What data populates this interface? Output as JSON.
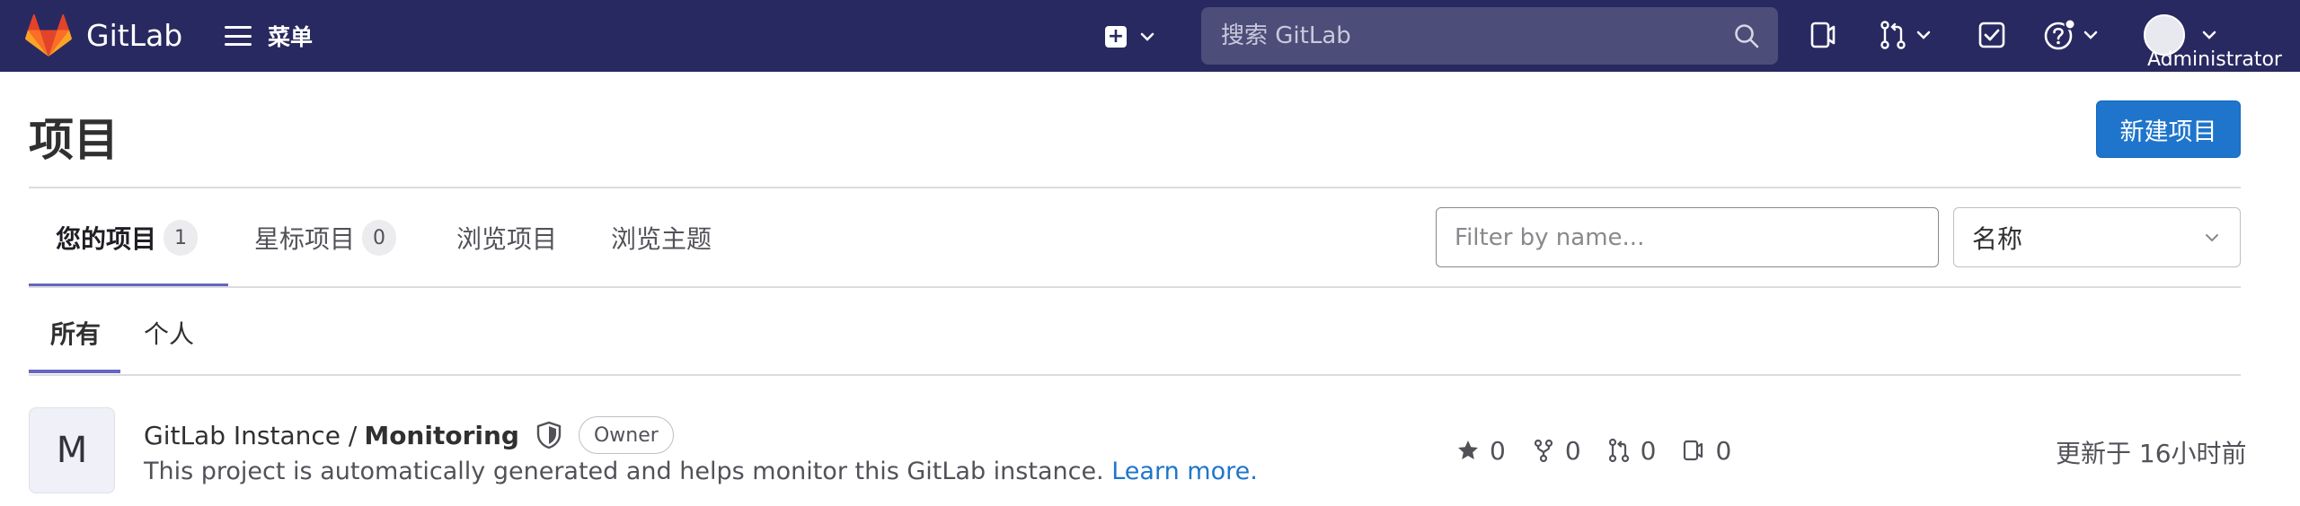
{
  "navbar": {
    "brand": "GitLab",
    "menu_label": "菜单",
    "search_placeholder": "搜索 GitLab",
    "user_label": "Administrator"
  },
  "header": {
    "title": "项目",
    "new_project_button": "新建项目"
  },
  "tabs": [
    {
      "label": "您的项目",
      "count": "1"
    },
    {
      "label": "星标项目",
      "count": "0"
    },
    {
      "label": "浏览项目"
    },
    {
      "label": "浏览主题"
    }
  ],
  "filter": {
    "placeholder": "Filter by name...",
    "sort_selected": "名称"
  },
  "subtabs": [
    {
      "label": "所有"
    },
    {
      "label": "个人"
    }
  ],
  "project": {
    "avatar_letter": "M",
    "namespace": "GitLab Instance /",
    "name": "Monitoring",
    "role": "Owner",
    "description": "This project is automatically generated and helps monitor this GitLab instance.",
    "learn_more": "Learn more.",
    "stars": "0",
    "forks": "0",
    "merge_requests": "0",
    "issues": "0",
    "updated": "更新于 16小时前"
  },
  "colors": {
    "navbar_bg": "#292961",
    "primary": "#1f75cb",
    "tab_active_underline": "#6666c4"
  }
}
